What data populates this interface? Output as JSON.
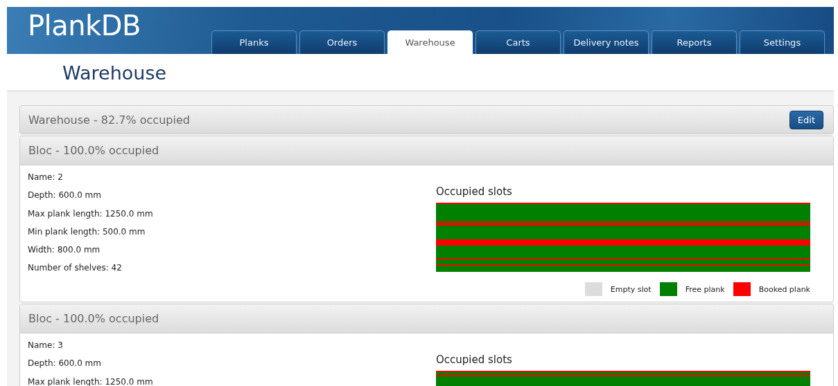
{
  "header": {
    "logo": "PlankDB",
    "tabs": [
      {
        "label": "Planks",
        "selected": false
      },
      {
        "label": "Orders",
        "selected": false
      },
      {
        "label": "Warehouse",
        "selected": true
      },
      {
        "label": "Carts",
        "selected": false
      },
      {
        "label": "Delivery notes",
        "selected": false
      },
      {
        "label": "Reports",
        "selected": false
      },
      {
        "label": "Settings",
        "selected": false
      }
    ]
  },
  "page_title": "Warehouse",
  "warehouse": {
    "title": "Warehouse - 82.7% occupied",
    "edit_button": "Edit"
  },
  "blocs": [
    {
      "title": "Bloc - 100.0% occupied",
      "details": [
        "Name: 2",
        "Depth: 600.0 mm",
        "Max plank length: 1250.0 mm",
        "Min plank length: 500.0 mm",
        "Width: 800.0 mm",
        "Number of shelves: 42"
      ],
      "chart_title": "Occupied slots",
      "legend": [
        {
          "label": "Empty slot",
          "color": "#dcdcdc"
        },
        {
          "label": "Free plank",
          "color": "#008000"
        },
        {
          "label": "Booked plank",
          "color": "#ff0000"
        }
      ]
    },
    {
      "title": "Bloc - 100.0% occupied",
      "details": [
        "Name: 3",
        "Depth: 600.0 mm",
        "Max plank length: 1250.0 mm"
      ],
      "chart_title": "Occupied slots"
    }
  ]
}
